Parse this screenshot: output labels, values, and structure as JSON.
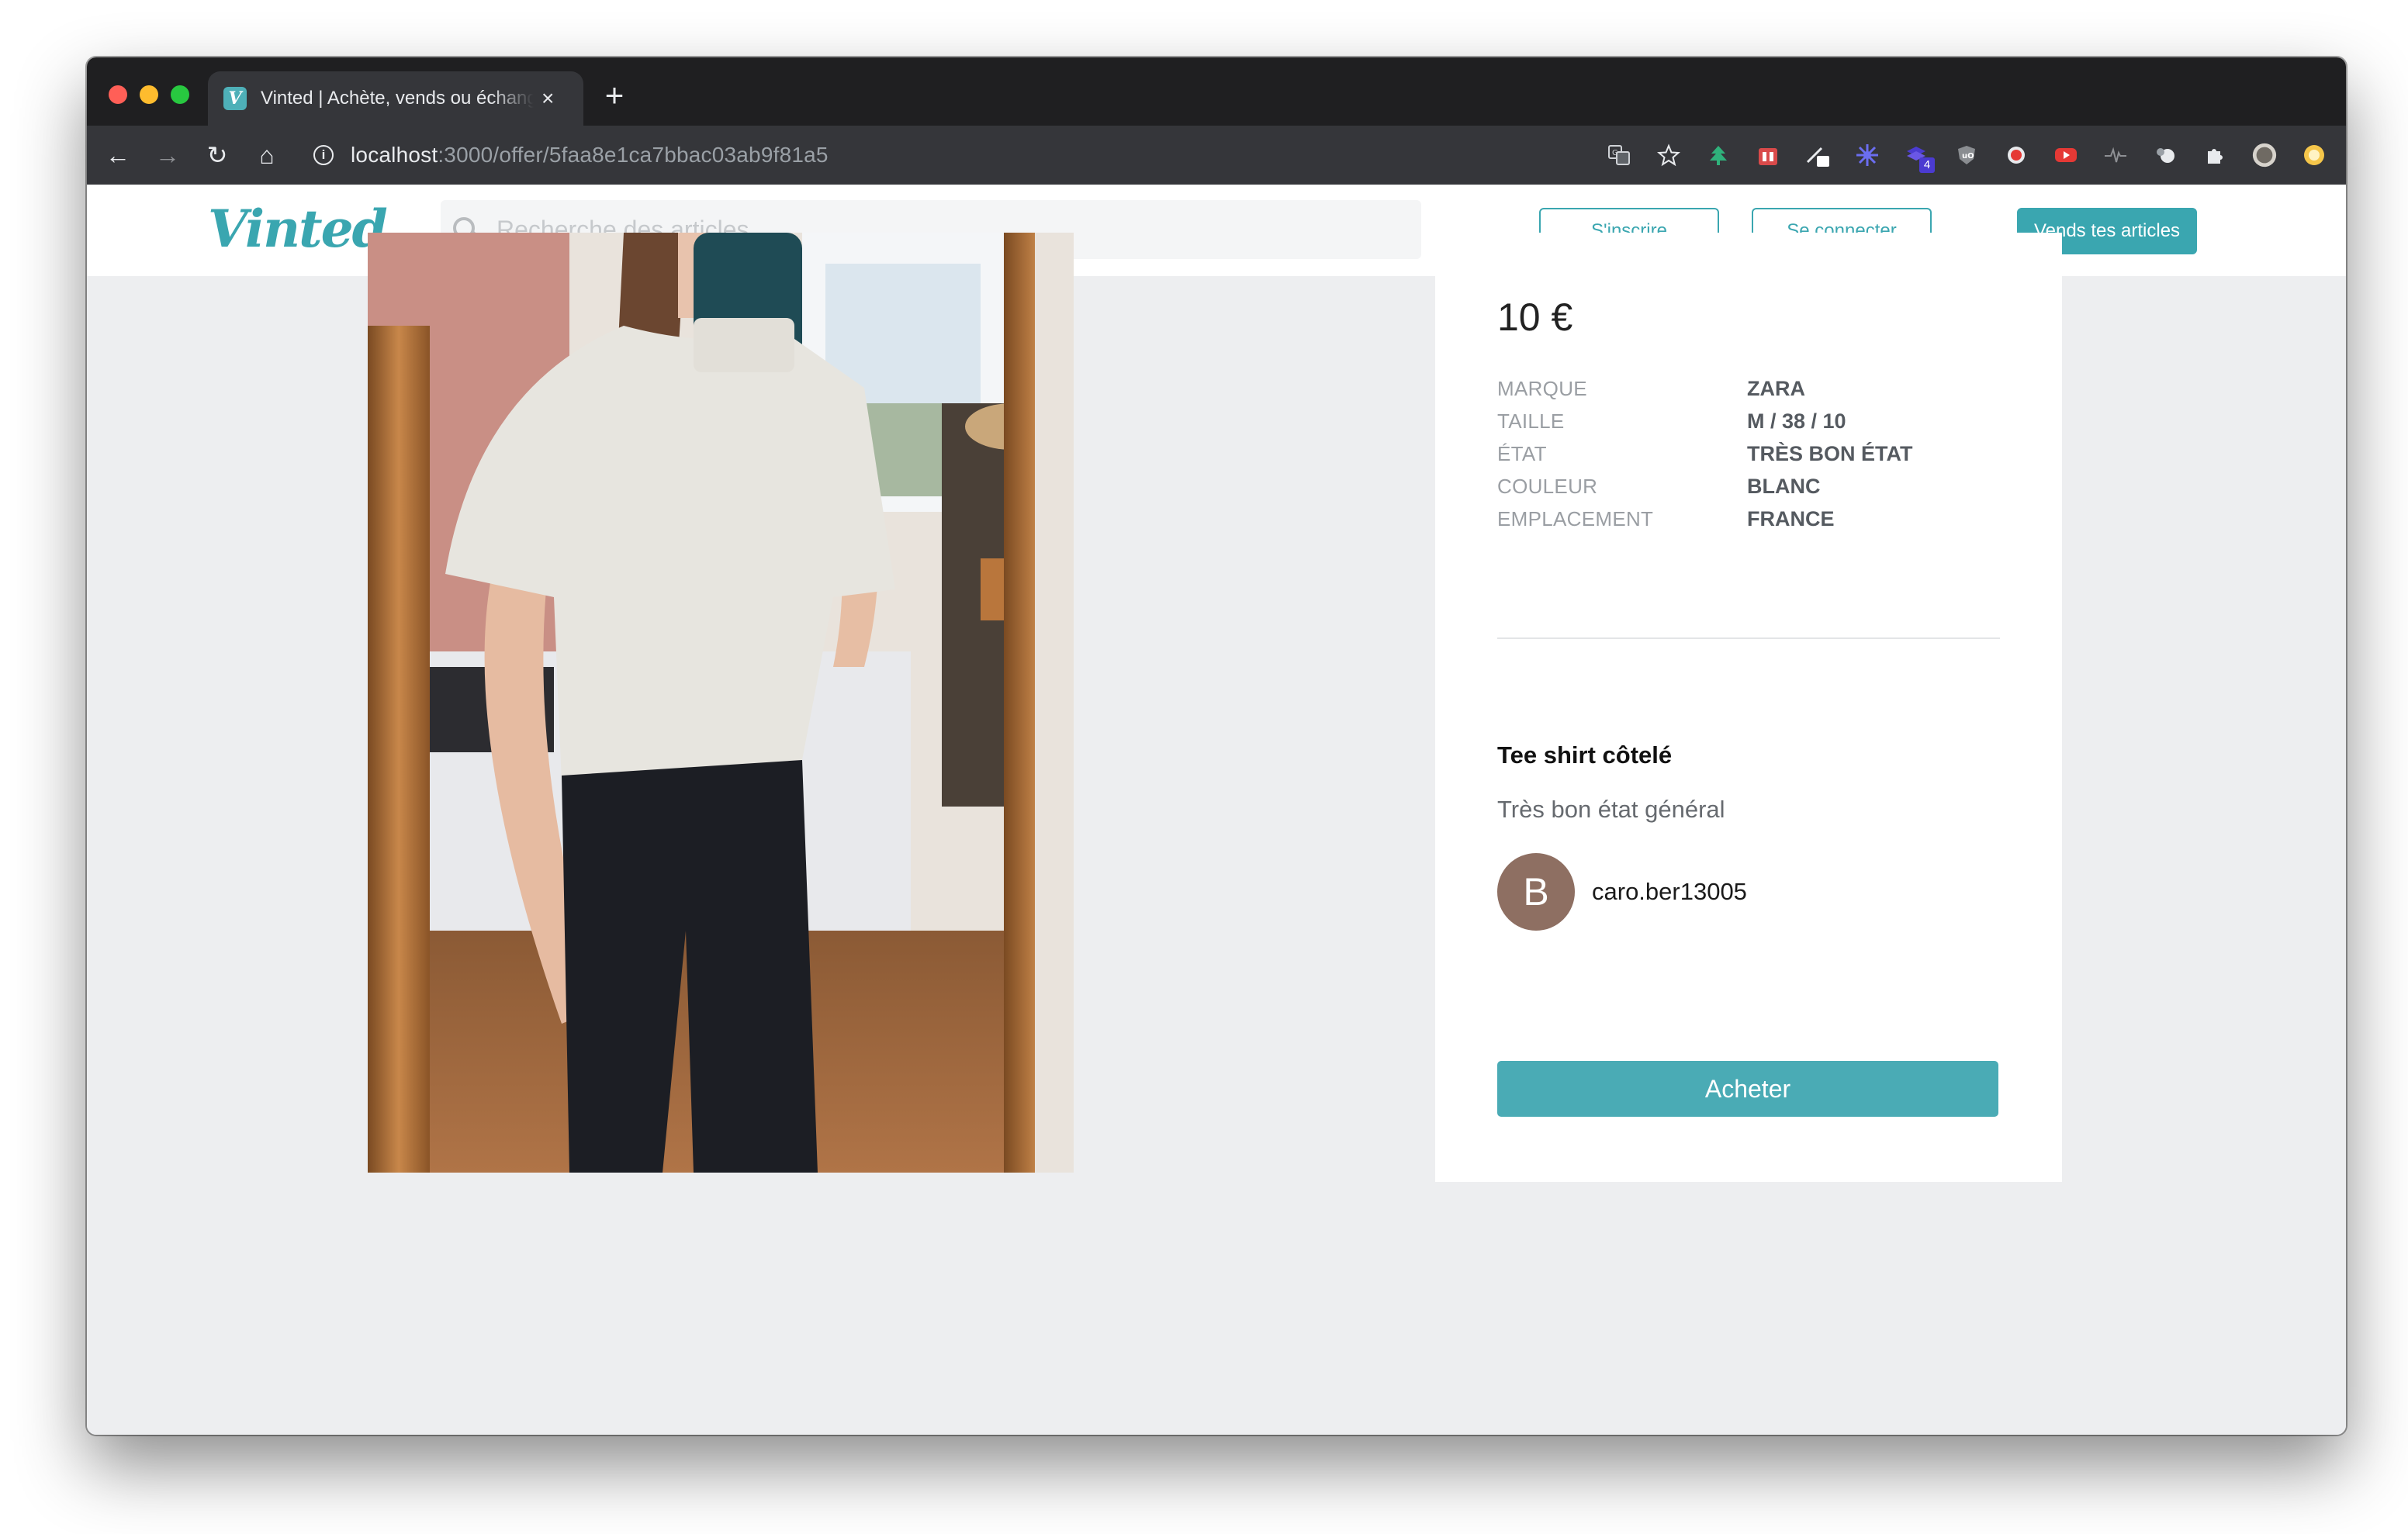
{
  "browser": {
    "tab_title": "Vinted | Achète, vends ou échange",
    "tab_close_symbol": "×",
    "new_tab_symbol": "+",
    "favicon_letter": "V",
    "url_host": "localhost",
    "url_path": ":3000/offer/5faa8e1ca7bbac03ab9f81a5",
    "nav": {
      "back_symbol": "←",
      "forward_symbol": "→",
      "reload_symbol": "↻",
      "home_symbol": "⌂",
      "info_symbol": "i"
    },
    "extensions": [
      "translate-icon",
      "star-icon",
      "tree-icon",
      "gift-icon",
      "pen-icon",
      "puzzle-flower-icon",
      "stack-icon",
      "ublock-icon",
      "record-icon",
      "youtube-icon",
      "pulse-icon",
      "cookie-icon",
      "extensions-icon",
      "profile-avatar-icon",
      "smiley-icon"
    ],
    "extension_badge": "4"
  },
  "site": {
    "logo": "Vinted",
    "search_placeholder": "Recherche des articles",
    "register_label": "S'inscrire",
    "login_label": "Se connecter",
    "sell_label": "Vends tes articles",
    "accent_color": "#3aa6b0"
  },
  "offer": {
    "price": "10 €",
    "details": [
      {
        "key": "MARQUE",
        "value": "ZARA"
      },
      {
        "key": "TAILLE",
        "value": "M / 38 / 10"
      },
      {
        "key": "ÉTAT",
        "value": "TRÈS BON ÉTAT"
      },
      {
        "key": "COULEUR",
        "value": "BLANC"
      },
      {
        "key": "EMPLACEMENT",
        "value": "FRANCE"
      }
    ],
    "name": "Tee shirt côtelé",
    "description": "Très bon état général",
    "seller": {
      "avatar_letter": "B",
      "username": "caro.ber13005"
    },
    "buy_label": "Acheter"
  }
}
